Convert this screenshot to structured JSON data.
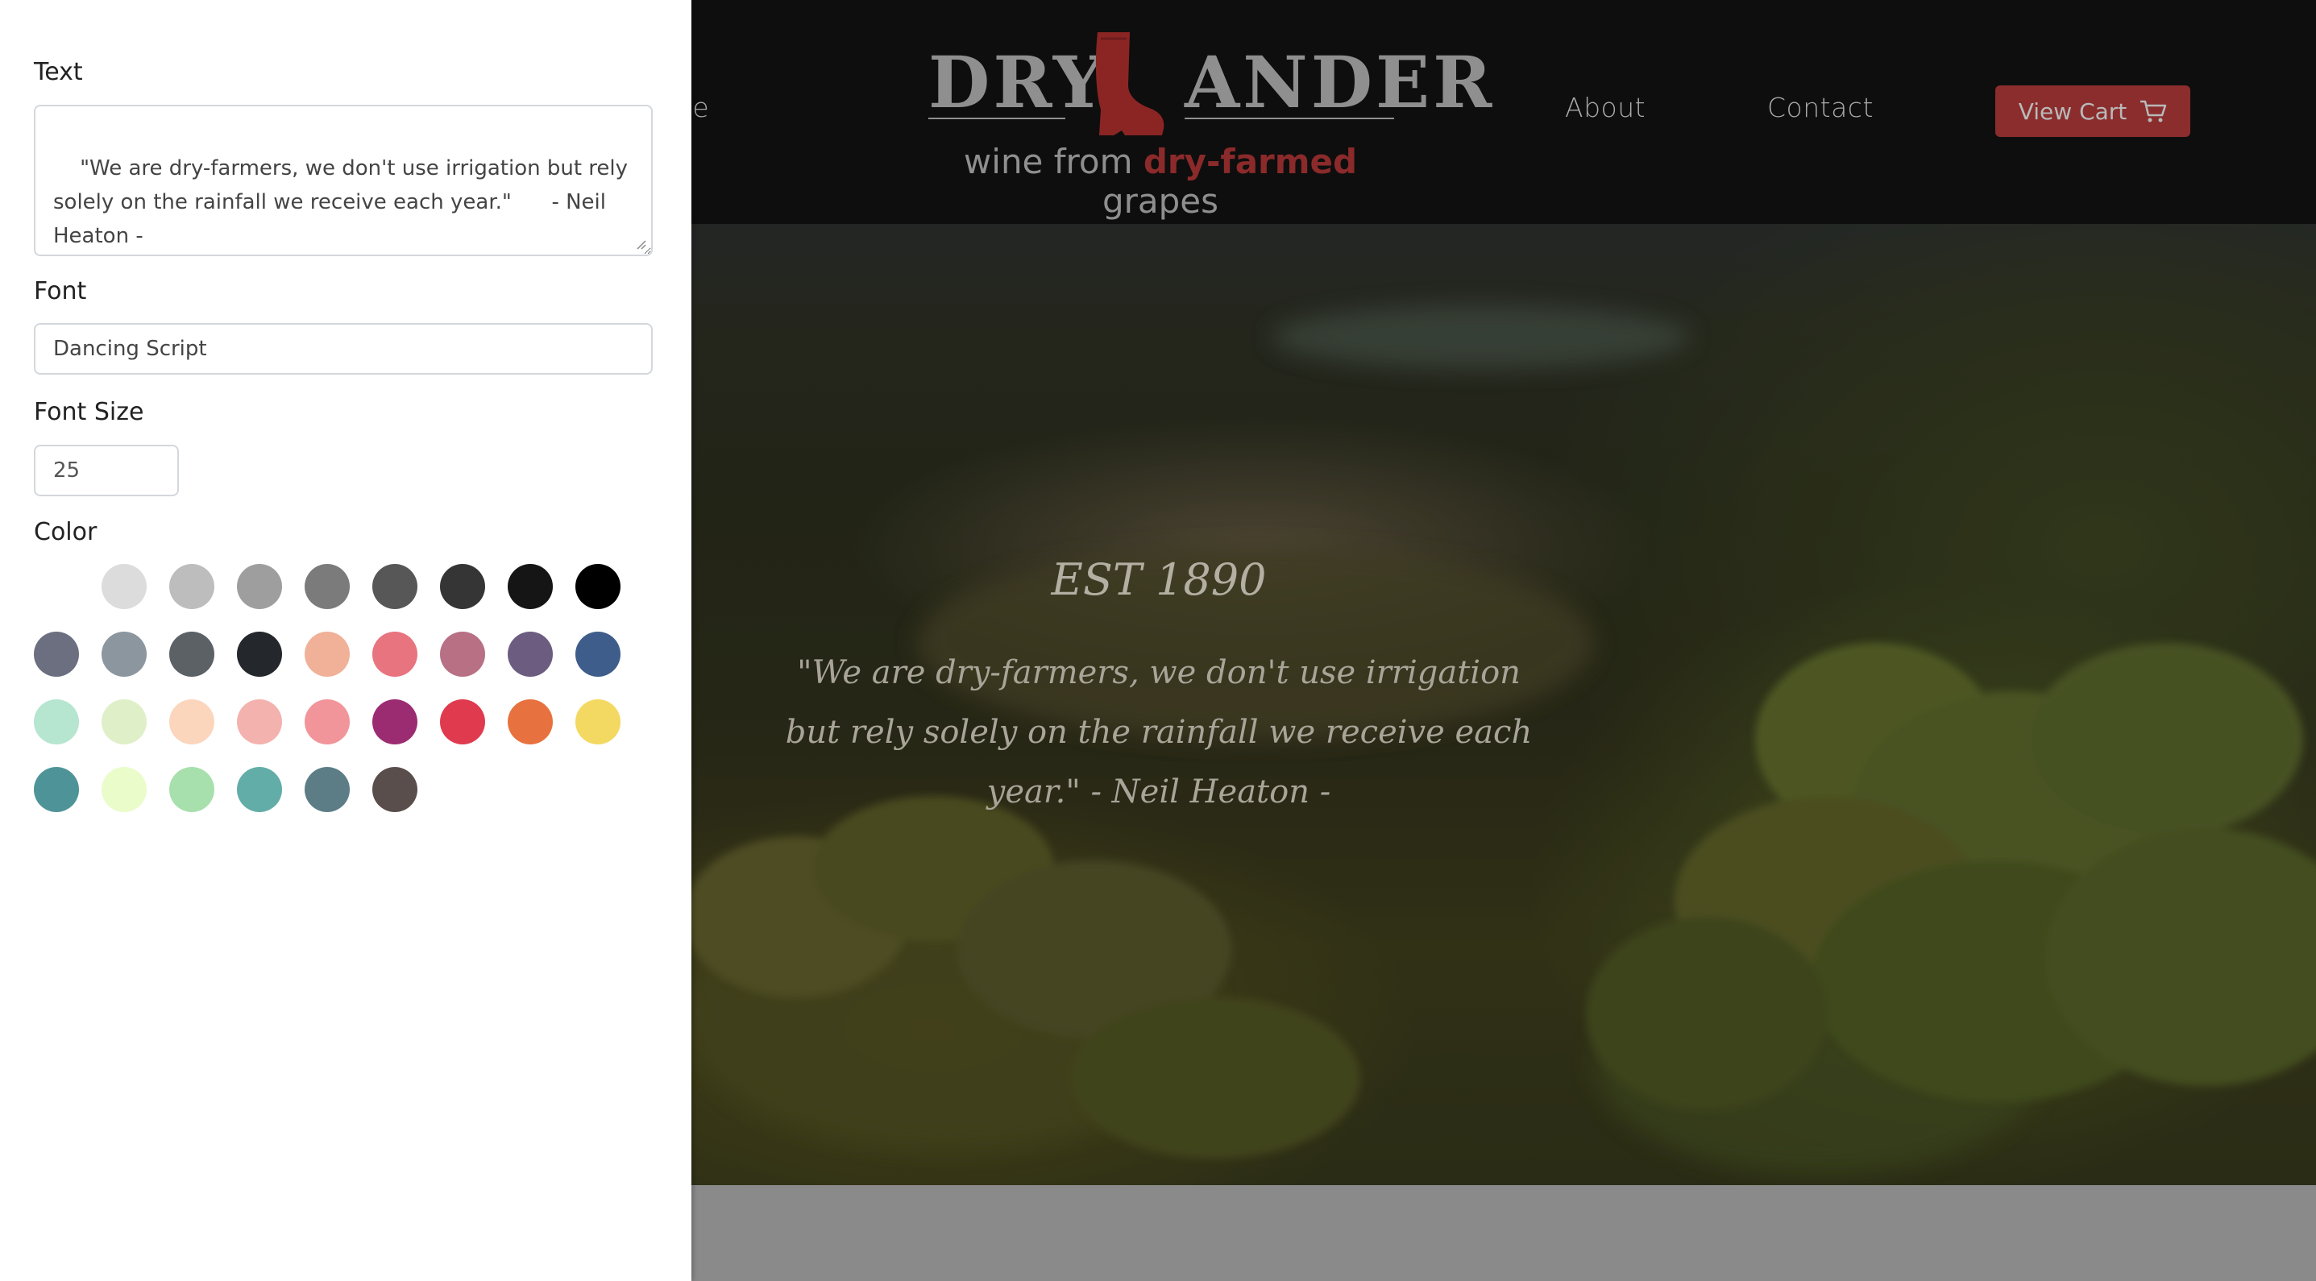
{
  "editor": {
    "text_label": "Text",
    "text_value": "\"We are dry-farmers, we don't use irrigation but rely solely on the rainfall we receive each year.\"      - Neil Heaton -",
    "font_label": "Font",
    "font_value": "Dancing Script",
    "font_size_label": "Font Size",
    "font_size_value": "25",
    "color_label": "Color",
    "colors": [
      [
        "#ffffff",
        "#dcdcdc",
        "#bdbdbd",
        "#9e9e9e",
        "#7b7b7b",
        "#575757",
        "#353535",
        "#151515",
        "#000000"
      ],
      [
        "#6b6f80",
        "#8b969f",
        "#5c6166",
        "#24272b",
        "#f0b198",
        "#e8747f",
        "#b87085",
        "#6c5d80",
        "#3f5d8a"
      ],
      [
        "#b6e5d0",
        "#dff0c8",
        "#fbd6bd",
        "#f4b2ae",
        "#f1959b",
        "#9b2c72",
        "#e03a4e",
        "#e7723f",
        "#f3d962"
      ],
      [
        "#4e9397",
        "#e9fcc9",
        "#a7e0ad",
        "#62ada7",
        "#5d7d86",
        "#5a4e4d"
      ]
    ]
  },
  "site": {
    "nav": {
      "home_partial": "ne",
      "about": "About",
      "contact": "Contact",
      "view_cart": "View Cart"
    },
    "logo": {
      "left_word": "DRY",
      "right_word": "ANDER",
      "tagline_prefix": "wine from ",
      "tagline_highlight": "dry-farmed",
      "tagline_suffix": " grapes"
    },
    "hero": {
      "est": "EST 1890",
      "quote": "\"We are dry-farmers, we don't use irrigation but rely solely on the rainfall we receive each year.\"   - Neil Heaton -"
    }
  }
}
